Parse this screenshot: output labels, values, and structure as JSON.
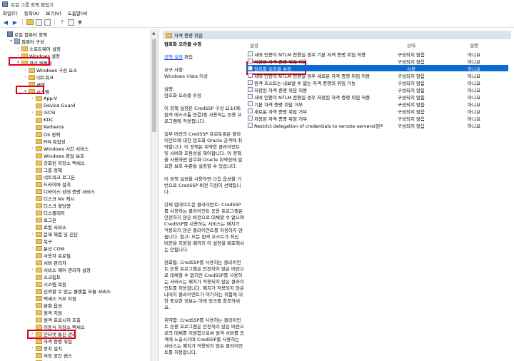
{
  "window": {
    "title": "로컬 그룹 정책 편집기"
  },
  "menu": [
    "파일(F)",
    "동작(A)",
    "보기(V)",
    "도움말(H)"
  ],
  "tree": [
    {
      "label": "로컬 컴퓨터 정책",
      "level": 0,
      "exp": "",
      "icon": "policy"
    },
    {
      "label": "컴퓨터 구성",
      "level": 1,
      "exp": "▾",
      "icon": "computer"
    },
    {
      "label": "소프트웨어 설정",
      "level": 2,
      "exp": "›",
      "icon": "folder"
    },
    {
      "label": "Windows 설정",
      "level": 2,
      "exp": "›",
      "icon": "folder"
    },
    {
      "label": "관리 템플릿",
      "level": 2,
      "exp": "▾",
      "icon": "folder"
    },
    {
      "label": "Windows 구성 요소",
      "level": 3,
      "exp": "›",
      "icon": "folder"
    },
    {
      "label": "네트워크",
      "level": 3,
      "exp": "›",
      "icon": "folder"
    },
    {
      "label": "서버",
      "level": 3,
      "exp": "",
      "icon": "folder"
    },
    {
      "label": "시스템",
      "level": 3,
      "exp": "▾",
      "icon": "folder"
    },
    {
      "label": "App-V",
      "level": 4,
      "exp": "›",
      "icon": "folder"
    },
    {
      "label": "Device Guard",
      "level": 4,
      "exp": "",
      "icon": "folder"
    },
    {
      "label": "iSCSI",
      "level": 4,
      "exp": "›",
      "icon": "folder"
    },
    {
      "label": "KDC",
      "level": 4,
      "exp": "",
      "icon": "folder"
    },
    {
      "label": "Kerberos",
      "level": 4,
      "exp": "",
      "icon": "folder"
    },
    {
      "label": "OS 정책",
      "level": 4,
      "exp": "",
      "icon": "folder"
    },
    {
      "label": "PIN 복잡성",
      "level": 4,
      "exp": "",
      "icon": "folder"
    },
    {
      "label": "Windows 시간 서비스",
      "level": 4,
      "exp": "›",
      "icon": "folder"
    },
    {
      "label": "Windows 파일 보호",
      "level": 4,
      "exp": "",
      "icon": "folder"
    },
    {
      "label": "강화된 저장소 액세스",
      "level": 4,
      "exp": "",
      "icon": "folder"
    },
    {
      "label": "그룹 정책",
      "level": 4,
      "exp": "",
      "icon": "folder"
    },
    {
      "label": "네트워크 로그온",
      "level": 4,
      "exp": "",
      "icon": "folder"
    },
    {
      "label": "드라이버 설치",
      "level": 4,
      "exp": "",
      "icon": "folder"
    },
    {
      "label": "디바이스 상태 증명 서비스",
      "level": 4,
      "exp": "",
      "icon": "folder"
    },
    {
      "label": "디스크 NV 캐시",
      "level": 4,
      "exp": "",
      "icon": "folder"
    },
    {
      "label": "디스크 할당량",
      "level": 4,
      "exp": "",
      "icon": "folder"
    },
    {
      "label": "디스플레이",
      "level": 4,
      "exp": "",
      "icon": "folder"
    },
    {
      "label": "로그온",
      "level": 4,
      "exp": "",
      "icon": "folder"
    },
    {
      "label": "로컬 서비스",
      "level": 4,
      "exp": "",
      "icon": "folder"
    },
    {
      "label": "문제 해결 및 진단",
      "level": 4,
      "exp": "›",
      "icon": "folder"
    },
    {
      "label": "복구",
      "level": 4,
      "exp": "",
      "icon": "folder"
    },
    {
      "label": "분산 COM",
      "level": 4,
      "exp": "›",
      "icon": "folder"
    },
    {
      "label": "사용자 프로필",
      "level": 4,
      "exp": "",
      "icon": "folder"
    },
    {
      "label": "서버 관리자",
      "level": 4,
      "exp": "",
      "icon": "folder"
    },
    {
      "label": "서비스 제어 관리자 설정",
      "level": 4,
      "exp": "›",
      "icon": "folder"
    },
    {
      "label": "스크립트",
      "level": 4,
      "exp": "",
      "icon": "folder"
    },
    {
      "label": "시스템 복원",
      "level": 4,
      "exp": "",
      "icon": "folder"
    },
    {
      "label": "신뢰할 수 있는 플랫폼 모듈 서비스",
      "level": 4,
      "exp": "",
      "icon": "folder"
    },
    {
      "label": "액세스 거부 지원",
      "level": 4,
      "exp": "",
      "icon": "folder"
    },
    {
      "label": "완화 옵션",
      "level": 4,
      "exp": "",
      "icon": "folder"
    },
    {
      "label": "원격 지원",
      "level": 4,
      "exp": "",
      "icon": "folder"
    },
    {
      "label": "원격 프로시저 호출",
      "level": 4,
      "exp": "",
      "icon": "folder"
    },
    {
      "label": "이동식 저장소 액세스",
      "level": 4,
      "exp": "",
      "icon": "folder"
    },
    {
      "label": "인터넷 통신 관리",
      "level": 4,
      "exp": "›",
      "icon": "folder"
    },
    {
      "label": "자격 증명 위임",
      "level": 4,
      "exp": "",
      "icon": "folder"
    },
    {
      "label": "장치 설치",
      "level": 4,
      "exp": "›",
      "icon": "folder"
    },
    {
      "label": "저장 공간 센스",
      "level": 4,
      "exp": "",
      "icon": "folder"
    },
    {
      "label": "저장소 상태",
      "level": 4,
      "exp": "",
      "icon": "folder"
    }
  ],
  "right": {
    "banner": "자격 증명 위임",
    "desc_title": "암호화 오라클 수정",
    "desc_link": "정책 설정",
    "desc_link_suffix": " 편집",
    "desc_paragraphs": [
      "요구 사항:\nWindows Vista 이상",
      "설명:\n암호화 오라클 수정",
      "이 정책 설정은 CredSSP 구성 요소(예: 원격 데스크톱 연결)를 사용하는 응용 프로그램에 적용됩니다.",
      "일부 버전의 CredSSP 프로토콜은 클라이언트에 대한 암호화 Oracle 공격에 취약합니다. 이 정책은 취약한 클라이언트 및 서버와 호환성을 제어합니다. 이 정책을 사용하면 암호화 Oracle 취약성에 필요한 보호 수준을 설정할 수 있습니다.",
      "이 정책 설정을 사용하면 다음 옵션을 기반으로 CredSSP 버전 지원이 선택됩니다.",
      "강제 업데이트된 클라이언트: CredSSP를 사용하는 클라이언트 응용 프로그램은 안전하지 않은 버전으로 대체할 수 없으며 CredSSP를 사용하는 서비스는 패치가 적용되지 않은 클라이언트를 허용하지 않습니다. 참고: 모든 원격 호스트가 최신 버전을 지원할 때까지 이 설정을 배포해서는 안됩니다.",
      "완화됨: CredSSP를 사용하는 클라이언트 응용 프로그램은 안전하지 않은 버전으로 대체할 수 없지만 CredSSP를 사용하는 서비스는 패치가 적용되지 않은 클라이언트를 허용합니다. 패치가 적용되지 않은 나머지 클라이언트가 야기하는 위험에 대한 중요한 정보는 아래 링크를 참조하세요.",
      "취약함: CredSSP를 사용하는 클라이언트 응용 프로그램은 안전하지 않은 버전으로의 대체를 지원함으로써 원격 서버를 공격에 노출시키며 CredSSP를 사용하는 서비스는 패치가 적용되지 않은 클라이언트를 허용합니다.",
      "보호를 위한 취약성 및 서비스 요구"
    ],
    "columns": [
      "설정",
      "상태",
      "설명"
    ],
    "rows": [
      {
        "name": "서버 인증이 NTLM 전용일 경우 기본 자격 증명 위임 허용",
        "state": "구성되지 않음",
        "desc": "아니요"
      },
      {
        "name": "저장된 자격 증명 위임 허용",
        "state": "구성되지 않음",
        "desc": "아니요"
      },
      {
        "name": "암호화 오라클 수정",
        "state": "사용",
        "desc": "아니요",
        "selected": true
      },
      {
        "name": "서버 인증이 NTLM 전용일 경우 새로운 자격 증명 위임 허용",
        "state": "구성되지 않음",
        "desc": "아니요"
      },
      {
        "name": "원격 호스트는 내보낼 수 없는 자격 증명의 위임 가능",
        "state": "구성되지 않음",
        "desc": "아니요"
      },
      {
        "name": "저장된 자격 증명 위임 허용",
        "state": "구성되지 않음",
        "desc": "아니요"
      },
      {
        "name": "서버 인증이 NTLM 전용일 경우 저장된 자격 증명 위임 허용",
        "state": "구성되지 않음",
        "desc": "아니요"
      },
      {
        "name": "기본 자격 증명 위임 거부",
        "state": "구성되지 않음",
        "desc": "아니요"
      },
      {
        "name": "새로운 자격 증명 위임 거부",
        "state": "구성되지 않음",
        "desc": "아니요"
      },
      {
        "name": "저장된 자격 증명 위임 거부",
        "state": "구성되지 않음",
        "desc": "아니요"
      },
      {
        "name": "Restrict delegation of credentials to remote servers(원격 서...",
        "state": "구성되지 않음",
        "desc": "아니요"
      }
    ]
  },
  "colors": {
    "selection": "#0a6ad6",
    "banner": "#d9e4f1",
    "highlight": "#e0001a",
    "link": "#1a4fd8"
  }
}
